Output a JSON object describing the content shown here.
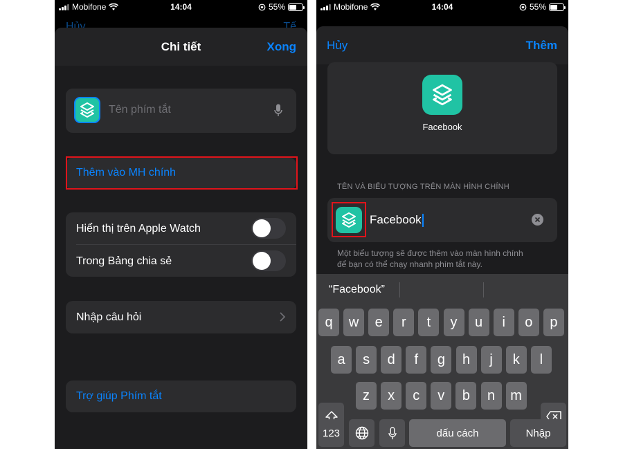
{
  "status_bar": {
    "carrier": "Mobifone",
    "time": "14:04",
    "battery": "55%",
    "battery_level": 0.55
  },
  "left_screen": {
    "behind_left": "Hủy",
    "behind_right": "Tế",
    "nav_title": "Chi tiết",
    "done_label": "Xong",
    "name_placeholder": "Tên phím tắt",
    "add_home_label": "Thêm vào MH chính",
    "toggles": [
      {
        "label": "Hiển thị trên Apple Watch",
        "on": false
      },
      {
        "label": "Trong Bảng chia sẻ",
        "on": false
      }
    ],
    "ask_question_label": "Nhập câu hỏi",
    "help_label": "Trợ giúp Phím tắt"
  },
  "right_screen": {
    "cancel_label": "Hủy",
    "add_label": "Thêm",
    "preview_name": "Facebook",
    "section_header": "TÊN VÀ BIỂU TƯỢNG TRÊN MÀN HÌNH CHÍNH",
    "name_value": "Facebook",
    "footer_line1": "Một biểu tượng sẽ được thêm vào màn hình chính",
    "footer_line2": "để bạn có thể chạy nhanh phím tắt này.",
    "keyboard": {
      "suggestion": "“Facebook”",
      "row1": [
        "q",
        "w",
        "e",
        "r",
        "t",
        "y",
        "u",
        "i",
        "o",
        "p"
      ],
      "row2": [
        "a",
        "s",
        "d",
        "f",
        "g",
        "h",
        "j",
        "k",
        "l"
      ],
      "row3": [
        "z",
        "x",
        "c",
        "v",
        "b",
        "n",
        "m"
      ],
      "numbers_label": "123",
      "space_label": "dấu cách",
      "return_label": "Nhập"
    }
  },
  "colors": {
    "accent": "#0a84ff",
    "highlight": "#e0141b",
    "icon_bg": "#20c3a4"
  }
}
